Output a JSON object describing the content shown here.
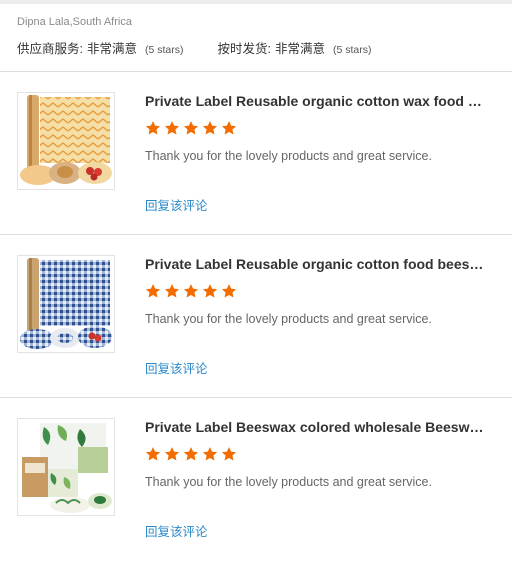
{
  "reviewer": {
    "name_location": "Dipna Lala,South Africa"
  },
  "supplier_rating": {
    "label": "供应商服务:",
    "value": "非常满意",
    "stars_text": "(5 stars)"
  },
  "delivery_rating": {
    "label": "按时发货:",
    "value": "非常满意",
    "stars_text": "(5 stars)"
  },
  "accent_colors": {
    "star": "#f26c00",
    "link": "#2a88c8"
  },
  "reviews": [
    {
      "product_title": "Private Label Reusable organic cotton wax food wraps",
      "rating": 5,
      "comment": "Thank you for the lovely products and great service.",
      "reply_label": "回复该评论"
    },
    {
      "product_title": "Private Label Reusable organic cotton food beeswax wraps",
      "rating": 5,
      "comment": "Thank you for the lovely products and great service.",
      "reply_label": "回复该评论"
    },
    {
      "product_title": "Private Label Beeswax colored wholesale Beeswax wraps",
      "rating": 5,
      "comment": "Thank you for the lovely products and great service.",
      "reply_label": "回复该评论"
    }
  ]
}
